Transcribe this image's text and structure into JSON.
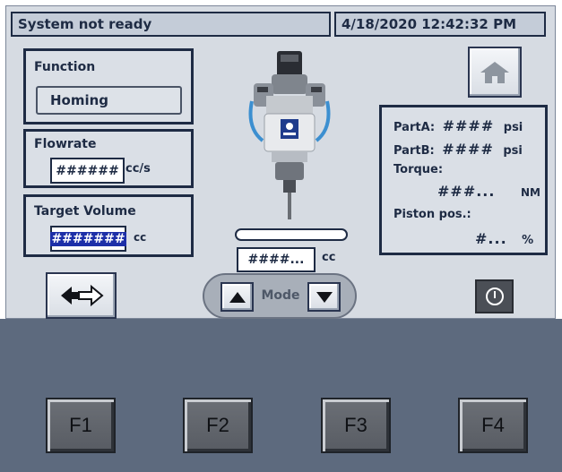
{
  "status": {
    "message": "System not ready",
    "datetime": "4/18/2020 12:42:32 PM"
  },
  "function_panel": {
    "title": "Function",
    "value": "Homing"
  },
  "flowrate_panel": {
    "title": "Flowrate",
    "value": "######",
    "unit": "cc/s"
  },
  "target_volume_panel": {
    "title": "Target Volume",
    "value": "#######",
    "unit": "cc"
  },
  "dispense": {
    "value": "####...",
    "unit": "cc",
    "progress": 0
  },
  "readings": {
    "parta_label": "PartA:",
    "parta_value": "####",
    "parta_unit": "psi",
    "partb_label": "PartB:",
    "partb_value": "####",
    "partb_unit": "psi",
    "torque_label": "Torque:",
    "torque_value": "###...",
    "torque_unit": "NM",
    "piston_label": "Piston pos.:",
    "piston_value": "#...",
    "piston_unit": "%"
  },
  "mode": {
    "label": "Mode"
  },
  "icons": {
    "home": "home-icon",
    "swap": "swap-arrows-icon",
    "power": "power-icon",
    "up": "triangle-up-icon",
    "down": "triangle-down-icon",
    "dispense_valve": "dispense-valve-image"
  },
  "function_keys": [
    "F1",
    "F2",
    "F3",
    "F4"
  ],
  "colors": {
    "screen_bg": "#d6dbe2",
    "frame": "#1e2b44",
    "lower_panel": "#5d6a7e",
    "key_face": "#626770"
  }
}
